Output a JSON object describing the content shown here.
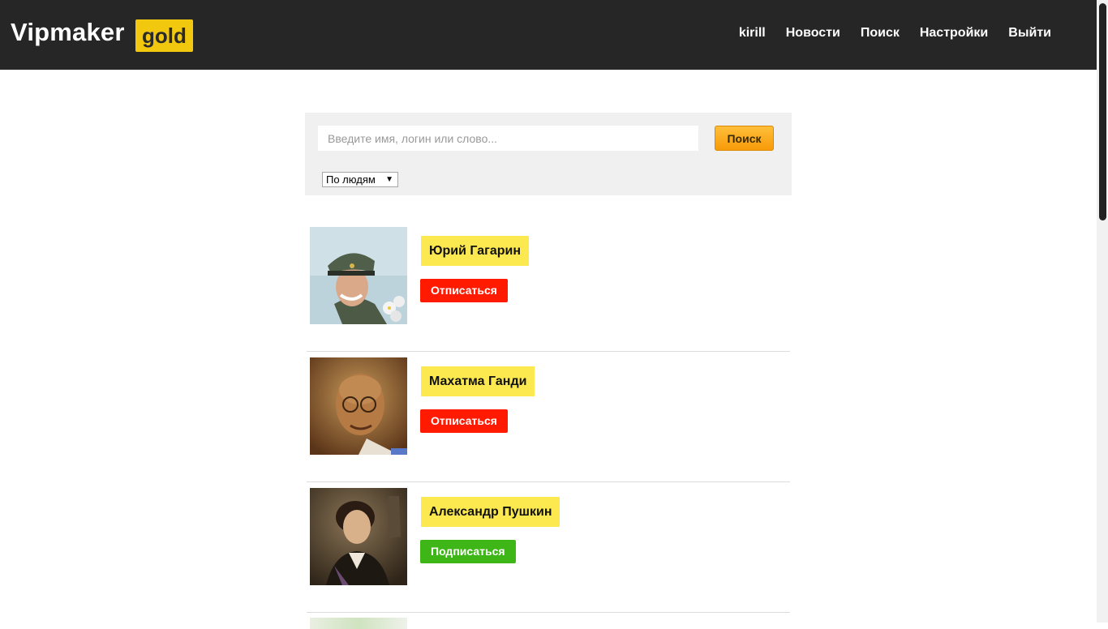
{
  "header": {
    "logo_text": "Vipmaker",
    "logo_badge": "gold",
    "nav": [
      "kirill",
      "Новости",
      "Поиск",
      "Настройки",
      "Выйти"
    ]
  },
  "search": {
    "placeholder": "Введите имя, логин или слово...",
    "value": "",
    "button_label": "Поиск",
    "filter_selected": "По людям"
  },
  "results": [
    {
      "name": "Юрий Гагарин",
      "action": "Отписаться",
      "action_type": "unsubscribe",
      "avatar_icon": "portrait-photo-icon"
    },
    {
      "name": "Махатма Ганди",
      "action": "Отписаться",
      "action_type": "unsubscribe",
      "avatar_icon": "portrait-photo-icon"
    },
    {
      "name": "Александр Пушкин",
      "action": "Подписаться",
      "action_type": "subscribe",
      "avatar_icon": "portrait-photo-icon"
    }
  ],
  "colors": {
    "header_bg": "#262626",
    "logo_badge": "#f2c80f",
    "name_badge": "#fce94f",
    "unsubscribe": "#ff1a00",
    "subscribe": "#3fb618",
    "search_button": "#f79b09"
  }
}
